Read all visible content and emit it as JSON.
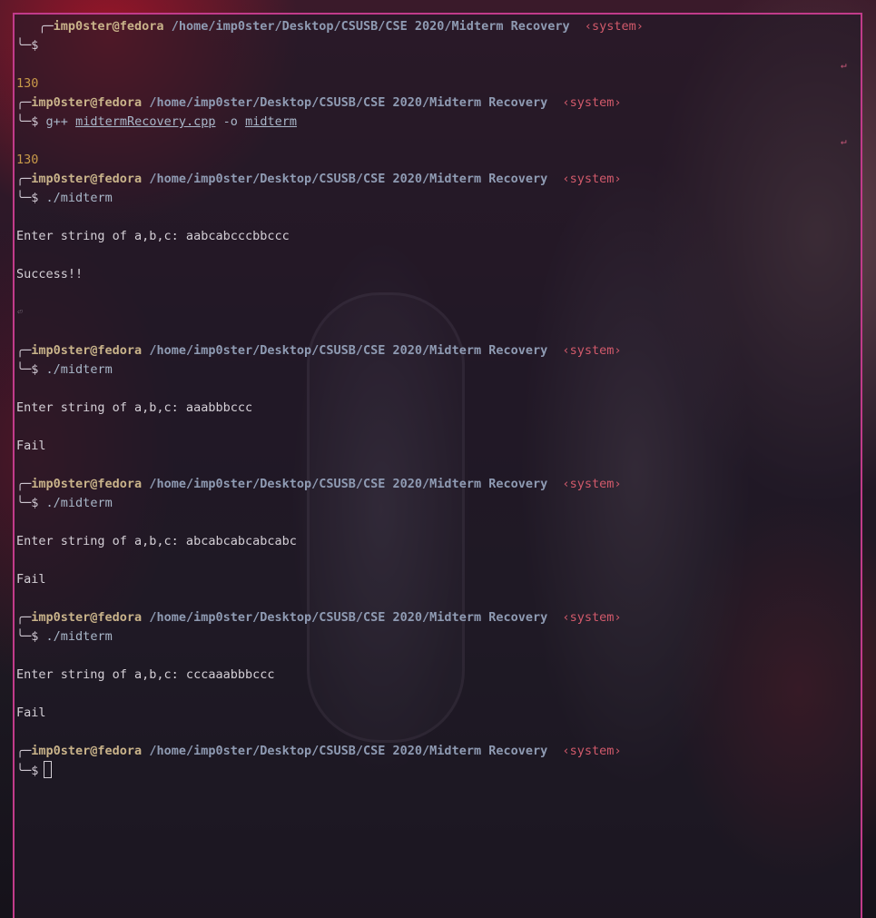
{
  "window": {
    "border_color": "#c13b8a"
  },
  "prompt": {
    "user": "imp0ster@fedora",
    "path": "/home/imp0ster/Desktop/CSUSB/CSE 2020/Midterm Recovery",
    "context": "‹system›",
    "symbol": "$"
  },
  "blocks": [
    {
      "exit_code": "",
      "command": "",
      "outputs": []
    },
    {
      "exit_code": "130",
      "command_prog": "g++",
      "command_file": "midtermRecovery.cpp",
      "command_flag": "-o",
      "command_out": "midterm"
    },
    {
      "exit_code": "130",
      "command": "./midterm",
      "outputs": [
        "Enter string of a,b,c: aabcabcccbbccc",
        "Success!!"
      ]
    },
    {
      "command": "./midterm",
      "outputs": [
        "Enter string of a,b,c: aaabbbccc",
        "Fail"
      ]
    },
    {
      "command": "./midterm",
      "outputs": [
        "Enter string of a,b,c: abcabcabcabcabc",
        "Fail"
      ]
    },
    {
      "command": "./midterm",
      "outputs": [
        "Enter string of a,b,c: cccaaabbbccc",
        "Fail"
      ]
    },
    {
      "command": "",
      "outputs": []
    }
  ],
  "icons": {
    "return_marker": "↵",
    "small_return": "⏎"
  }
}
